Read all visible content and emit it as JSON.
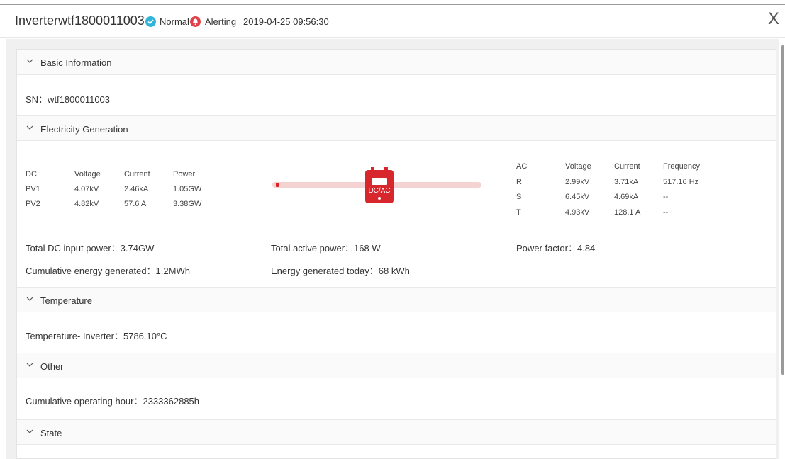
{
  "header": {
    "title": "Inverterwtf1800011003",
    "status_normal": "Normal",
    "status_alert": "Alerting",
    "timestamp": "2019-04-25 09:56:30",
    "close_label": "X"
  },
  "sections": {
    "basic": {
      "title": "Basic Information",
      "sn": "SN：wtf1800011003"
    },
    "generation": {
      "title": "Electricity Generation",
      "dc": {
        "headers": [
          "DC",
          "Voltage",
          "Current",
          "Power"
        ],
        "rows": [
          [
            "PV1",
            "4.07kV",
            "2.46kA",
            "1.05GW"
          ],
          [
            "PV2",
            "4.82kV",
            "57.6 A",
            "3.38GW"
          ]
        ]
      },
      "inverter_label": "DC/AC",
      "ac": {
        "headers": [
          "AC",
          "Voltage",
          "Current",
          "Frequency"
        ],
        "rows": [
          [
            "R",
            "2.99kV",
            "3.71kA",
            "517.16 Hz"
          ],
          [
            "S",
            "6.45kV",
            "4.69kA",
            "--"
          ],
          [
            "T",
            "4.93kV",
            "128.1 A",
            "--"
          ]
        ]
      },
      "total_dc_input": "Total DC input power：3.74GW",
      "total_active": "Total active power：168 W",
      "power_factor": "Power factor：4.84",
      "cumulative_energy": "Cumulative energy generated：1.2MWh",
      "energy_today": "Energy generated today：68 kWh"
    },
    "temperature": {
      "title": "Temperature",
      "inverter_temp": "Temperature- Inverter：5786.10°C"
    },
    "other": {
      "title": "Other",
      "operating_hours": "Cumulative operating hour：2333362885h"
    },
    "state": {
      "title": "State"
    }
  }
}
